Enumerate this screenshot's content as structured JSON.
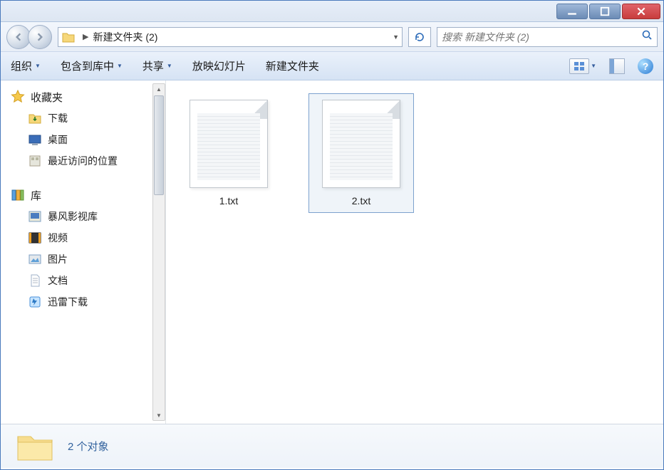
{
  "breadcrumb": {
    "folder": "新建文件夹 (2)"
  },
  "search": {
    "placeholder": "搜索 新建文件夹 (2)"
  },
  "toolbar": {
    "organize": "组织",
    "include": "包含到库中",
    "share": "共享",
    "slideshow": "放映幻灯片",
    "newfolder": "新建文件夹"
  },
  "sidebar": {
    "favorites": {
      "label": "收藏夹",
      "items": [
        "下载",
        "桌面",
        "最近访问的位置"
      ]
    },
    "libraries": {
      "label": "库",
      "items": [
        "暴风影视库",
        "视频",
        "图片",
        "文档",
        "迅雷下载"
      ]
    }
  },
  "files": [
    {
      "name": "1.txt",
      "selected": false
    },
    {
      "name": "2.txt",
      "selected": true
    }
  ],
  "status": {
    "text": "2 个对象"
  }
}
